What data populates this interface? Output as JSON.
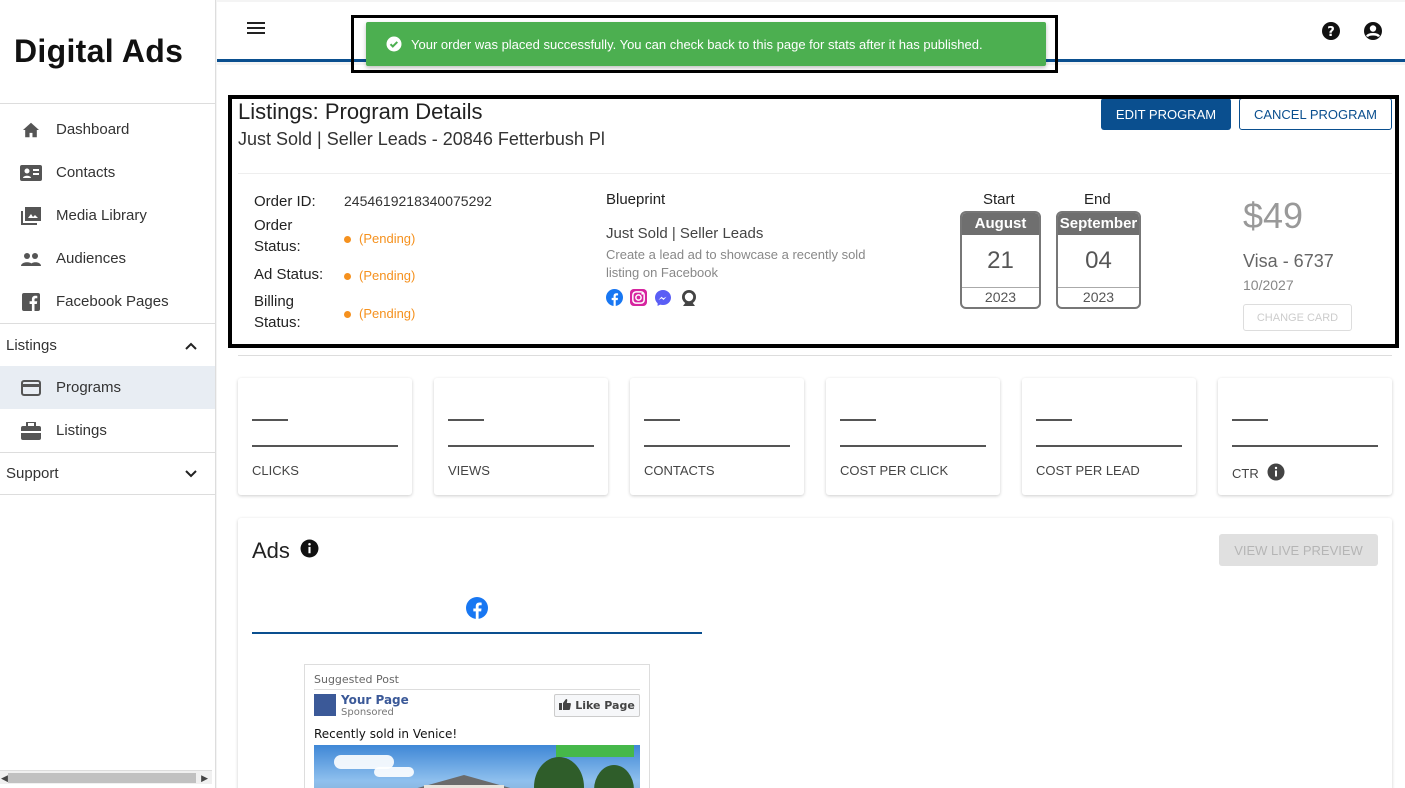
{
  "brand": "Digital Ads",
  "sidebar": {
    "items": [
      {
        "label": "Dashboard",
        "icon": "home-icon"
      },
      {
        "label": "Contacts",
        "icon": "contacts-icon"
      },
      {
        "label": "Media Library",
        "icon": "media-library-icon"
      },
      {
        "label": "Audiences",
        "icon": "audiences-icon"
      },
      {
        "label": "Facebook Pages",
        "icon": "facebook-icon"
      }
    ],
    "listings_section": "Listings",
    "listings_items": [
      {
        "label": "Programs",
        "icon": "credit-card-icon"
      },
      {
        "label": "Listings",
        "icon": "briefcase-icon"
      }
    ],
    "support_section": "Support"
  },
  "toast": {
    "message": "Your order was placed successfully. You can check back to this page for stats after it has published.",
    "color": "#4caf50"
  },
  "details": {
    "title": "Listings: Program Details",
    "subtitle": "Just Sold | Seller Leads - 20846 Fetterbush Pl",
    "edit_label": "EDIT PROGRAM",
    "cancel_label": "CANCEL PROGRAM",
    "order_id_label": "Order ID:",
    "order_id": "2454619218340075292",
    "order_status_label_1": "Order",
    "order_status_label_2": "Status:",
    "order_status": "(Pending)",
    "ad_status_label": "Ad Status:",
    "ad_status": "(Pending)",
    "billing_status_label_1": "Billing",
    "billing_status_label_2": "Status:",
    "billing_status": "(Pending)",
    "blueprint_heading": "Blueprint",
    "blueprint_name": "Just Sold | Seller Leads",
    "blueprint_description": "Create a lead ad to showcase a recently sold listing on Facebook",
    "blueprint_platforms": [
      "facebook-icon",
      "instagram-icon",
      "messenger-icon",
      "audience-network-icon"
    ],
    "start_label": "Start",
    "end_label": "End",
    "start": {
      "month": "August",
      "day": "21",
      "year": "2023"
    },
    "end": {
      "month": "September",
      "day": "04",
      "year": "2023"
    },
    "price": "$49",
    "card": "Visa - 6737",
    "card_expiry": "10/2027",
    "change_card_label": "CHANGE CARD"
  },
  "stats": [
    {
      "label": "CLICKS",
      "value": "—"
    },
    {
      "label": "VIEWS",
      "value": "—"
    },
    {
      "label": "CONTACTS",
      "value": "—"
    },
    {
      "label": "COST PER CLICK",
      "value": "—"
    },
    {
      "label": "COST PER LEAD",
      "value": "—"
    },
    {
      "label": "CTR",
      "value": "—"
    }
  ],
  "ads": {
    "title": "Ads",
    "preview_label": "VIEW LIVE PREVIEW",
    "post": {
      "suggested": "Suggested Post",
      "page_name": "Your Page",
      "sponsored": "Sponsored",
      "like_label": "Like Page",
      "text": "Recently sold in Venice!"
    }
  },
  "colors": {
    "primary": "#0a4f8f",
    "pending": "#f5911e",
    "success": "#4caf50"
  }
}
